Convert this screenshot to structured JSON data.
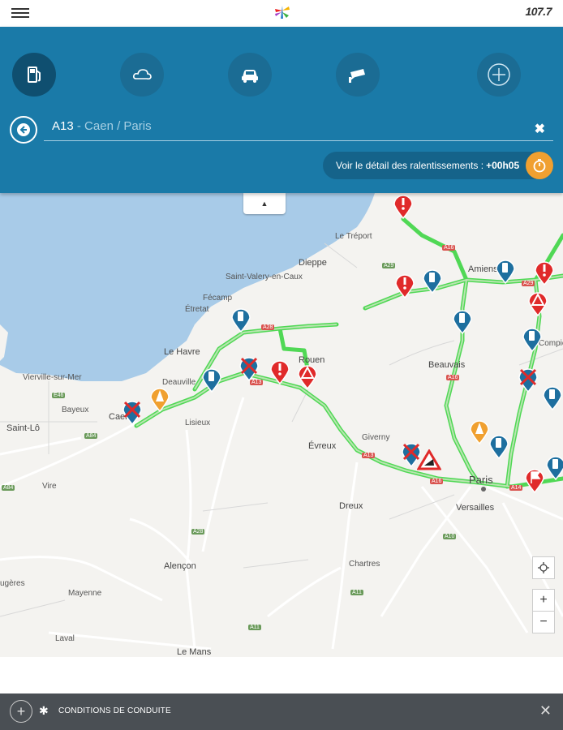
{
  "topbar": {
    "frequency": "107.7"
  },
  "categories": [
    {
      "name": "fuel",
      "icon": "fuel-pump-icon",
      "active": true
    },
    {
      "name": "weather",
      "icon": "cloud-icon",
      "active": false
    },
    {
      "name": "traffic",
      "icon": "car-icon",
      "active": false
    },
    {
      "name": "cameras",
      "icon": "camera-icon",
      "active": false
    },
    {
      "name": "more",
      "icon": "plus-icon",
      "active": false
    }
  ],
  "route": {
    "road": "A13",
    "separator": " - ",
    "direction": "Caen / Paris"
  },
  "slowdown": {
    "label": "Voir le détail des ralentissements :",
    "value": "+00h05"
  },
  "map": {
    "labels": {
      "treport": "Le Tréport",
      "dieppe": "Dieppe",
      "saint_valery": "Saint-Valery-en-Caux",
      "fecamp": "Fécamp",
      "etretat": "Étretat",
      "le_havre": "Le Havre",
      "deauville": "Deauville",
      "vierville": "Vierville-sur-Mer",
      "bayeux": "Bayeux",
      "caen": "Caen",
      "lisieux": "Lisieux",
      "rouen": "Rouen",
      "amiens": "Amiens",
      "beauvais": "Beauvais",
      "compiegne": "Compiègne",
      "saint_lo": "Saint-Lô",
      "vire": "Vire",
      "evreux": "Évreux",
      "giverny": "Giverny",
      "paris": "Paris",
      "versailles": "Versailles",
      "dreux": "Dreux",
      "chartres": "Chartres",
      "alencon": "Alençon",
      "mayenne": "Mayenne",
      "laval": "Laval",
      "le_mans": "Le Mans",
      "fougeres": "ugères"
    },
    "road_chips": [
      "A16",
      "A29",
      "A28",
      "A29",
      "A13",
      "A16",
      "A13",
      "A16",
      "A14",
      "A84",
      "E46",
      "A84",
      "A28",
      "A10",
      "A11",
      "A11"
    ],
    "controls": {
      "locate": "locate",
      "zoom_in": "+",
      "zoom_out": "−"
    },
    "collapse": "▲"
  },
  "bottombar": {
    "label": "CONDITIONS DE CONDUITE"
  },
  "colors": {
    "header_blue": "#1a7aa8",
    "accent_orange": "#f0a030",
    "marker_red": "#e02a2a",
    "marker_blue": "#1e6f9f",
    "route_green": "#36c93a"
  }
}
